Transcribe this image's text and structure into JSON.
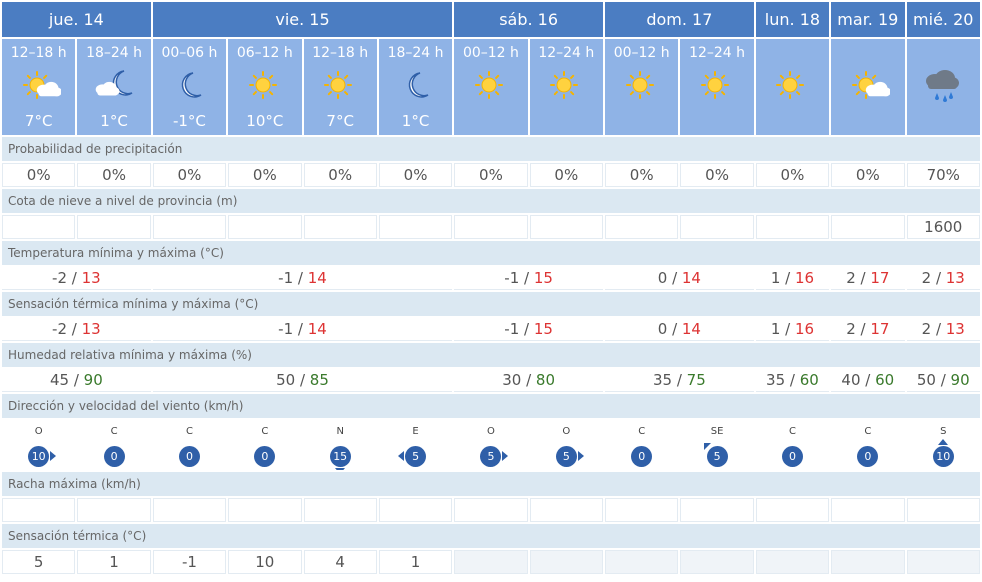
{
  "days": [
    {
      "label": "jue. 14"
    },
    {
      "label": "vie. 15"
    },
    {
      "label": "sáb. 16"
    },
    {
      "label": "dom. 17"
    },
    {
      "label": "lun. 18"
    },
    {
      "label": "mar. 19"
    },
    {
      "label": "mié. 20"
    }
  ],
  "periods": [
    {
      "label": "12–18 h",
      "temp": "7°C",
      "icon": "sun-cloud-icon"
    },
    {
      "label": "18–24 h",
      "temp": "1°C",
      "icon": "moon-cloud-icon"
    },
    {
      "label": "00–06 h",
      "temp": "-1°C",
      "icon": "moon-icon"
    },
    {
      "label": "06–12 h",
      "temp": "10°C",
      "icon": "sun-icon"
    },
    {
      "label": "12–18 h",
      "temp": "7°C",
      "icon": "sun-icon"
    },
    {
      "label": "18–24 h",
      "temp": "1°C",
      "icon": "moon-icon"
    },
    {
      "label": "00–12 h",
      "temp": "",
      "icon": "sun-icon"
    },
    {
      "label": "12–24 h",
      "temp": "",
      "icon": "sun-icon"
    },
    {
      "label": "00–12 h",
      "temp": "",
      "icon": "sun-icon"
    },
    {
      "label": "12–24 h",
      "temp": "",
      "icon": "sun-icon"
    },
    {
      "label": "",
      "temp": "",
      "icon": "sun-icon"
    },
    {
      "label": "",
      "temp": "",
      "icon": "sun-cloud-icon"
    },
    {
      "label": "",
      "temp": "",
      "icon": "rain-cloud-icon"
    }
  ],
  "sections": {
    "precip": "Probabilidad de precipitación",
    "snow": "Cota de nieve a nivel de provincia (m)",
    "temp": "Temperatura mínima y máxima (°C)",
    "feels": "Sensación térmica mínima y máxima (°C)",
    "humidity": "Humedad relativa mínima y máxima (%)",
    "wind": "Dirección y velocidad del viento (km/h)",
    "gust": "Racha máxima (km/h)",
    "feels_hourly": "Sensación térmica (°C)"
  },
  "precip": [
    "0%",
    "0%",
    "0%",
    "0%",
    "0%",
    "0%",
    "0%",
    "0%",
    "0%",
    "0%",
    "0%",
    "0%",
    "70%"
  ],
  "snow": [
    "",
    "",
    "",
    "",
    "",
    "",
    "",
    "",
    "",
    "",
    "",
    "",
    "1600"
  ],
  "temp": [
    {
      "min": "-2",
      "max": "13"
    },
    {
      "min": "-1",
      "max": "14"
    },
    {
      "min": "-1",
      "max": "15"
    },
    {
      "min": "0",
      "max": "14"
    },
    {
      "min": "1",
      "max": "16"
    },
    {
      "min": "2",
      "max": "17"
    },
    {
      "min": "2",
      "max": "13"
    }
  ],
  "feels": [
    {
      "min": "-2",
      "max": "13"
    },
    {
      "min": "-1",
      "max": "14"
    },
    {
      "min": "-1",
      "max": "15"
    },
    {
      "min": "0",
      "max": "14"
    },
    {
      "min": "1",
      "max": "16"
    },
    {
      "min": "2",
      "max": "17"
    },
    {
      "min": "2",
      "max": "13"
    }
  ],
  "humidity": [
    {
      "min": "45",
      "max": "90"
    },
    {
      "min": "50",
      "max": "85"
    },
    {
      "min": "30",
      "max": "80"
    },
    {
      "min": "35",
      "max": "75"
    },
    {
      "min": "35",
      "max": "60"
    },
    {
      "min": "40",
      "max": "60"
    },
    {
      "min": "50",
      "max": "90"
    }
  ],
  "wind": [
    {
      "dir": "O",
      "speed": "10"
    },
    {
      "dir": "C",
      "speed": "0"
    },
    {
      "dir": "C",
      "speed": "0"
    },
    {
      "dir": "C",
      "speed": "0"
    },
    {
      "dir": "N",
      "speed": "15"
    },
    {
      "dir": "E",
      "speed": "5"
    },
    {
      "dir": "O",
      "speed": "5"
    },
    {
      "dir": "O",
      "speed": "5"
    },
    {
      "dir": "C",
      "speed": "0"
    },
    {
      "dir": "SE",
      "speed": "5"
    },
    {
      "dir": "C",
      "speed": "0"
    },
    {
      "dir": "C",
      "speed": "0"
    },
    {
      "dir": "S",
      "speed": "10"
    }
  ],
  "feels_hourly": [
    "5",
    "1",
    "-1",
    "10",
    "4",
    "1"
  ],
  "colors": {
    "header": "#4b7dc2",
    "subheader": "#8fb3e6",
    "section": "#dbe8f2",
    "max": "#dd3333",
    "hum_max": "#3a7a2c",
    "wind": "#2f5fa8"
  }
}
